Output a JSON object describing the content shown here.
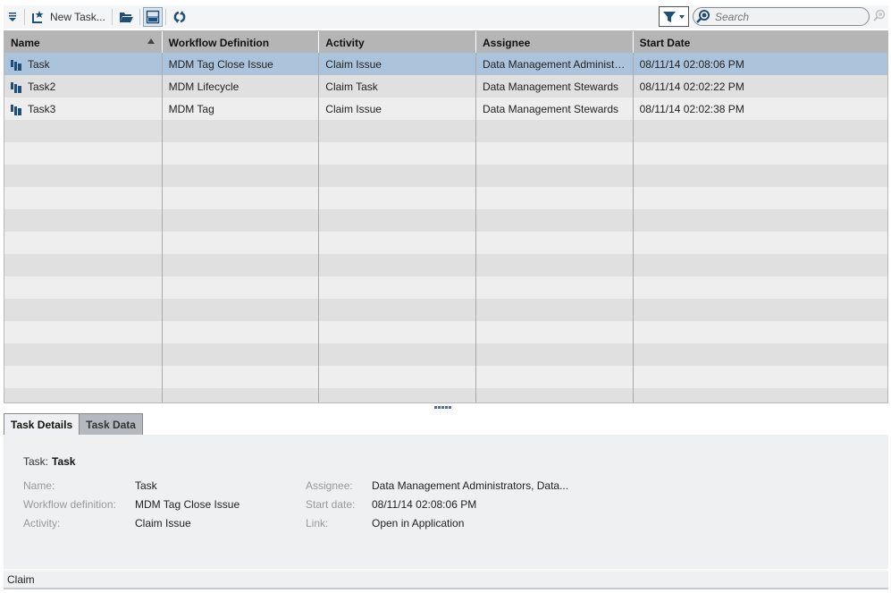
{
  "toolbar": {
    "menu_icon": "menu-down-icon",
    "new_task_label": "New Task...",
    "open_icon": "folder-open-icon",
    "layout_icon": "split-layout-icon",
    "refresh_icon": "refresh-icon",
    "filter_icon": "filter-icon",
    "search_placeholder": "Search",
    "search_value": ""
  },
  "grid": {
    "columns": [
      "Name",
      "Workflow Definition",
      "Activity",
      "Assignee",
      "Start Date"
    ],
    "sorted_column": "Name",
    "sort_direction": "ascending",
    "rows": [
      {
        "name": "Task",
        "workflow": "MDM Tag Close Issue",
        "activity": "Claim Issue",
        "assignee": "Data Management Administr...",
        "start": "08/11/14 02:08:06 PM",
        "selected": true
      },
      {
        "name": "Task2",
        "workflow": "MDM Lifecycle",
        "activity": "Claim Task",
        "assignee": "Data Management Stewards",
        "start": "08/11/14 02:02:22 PM",
        "selected": false
      },
      {
        "name": "Task3",
        "workflow": "MDM Tag",
        "activity": "Claim Issue",
        "assignee": "Data Management Stewards",
        "start": "08/11/14 02:02:38 PM",
        "selected": false
      }
    ]
  },
  "tabs": [
    {
      "label": "Task Details",
      "active": true
    },
    {
      "label": "Task Data",
      "active": false
    }
  ],
  "details": {
    "title_label": "Task:",
    "title_value": "Task",
    "name_label": "Name:",
    "name_value": "Task",
    "workflow_label": "Workflow definition:",
    "workflow_value": "MDM Tag Close Issue",
    "activity_label": "Activity:",
    "activity_value": "Claim Issue",
    "assignee_label": "Assignee:",
    "assignee_value": "Data Management Administrators, Data...",
    "start_label": "Start date:",
    "start_value": "08/11/14 02:08:06 PM",
    "link_label": "Link:",
    "link_value": "Open in Application"
  },
  "status": {
    "text": "Claim"
  },
  "colors": {
    "selection": "#acc4db",
    "header": "#b5b5b5",
    "icon_blue": "#1f4e79"
  }
}
